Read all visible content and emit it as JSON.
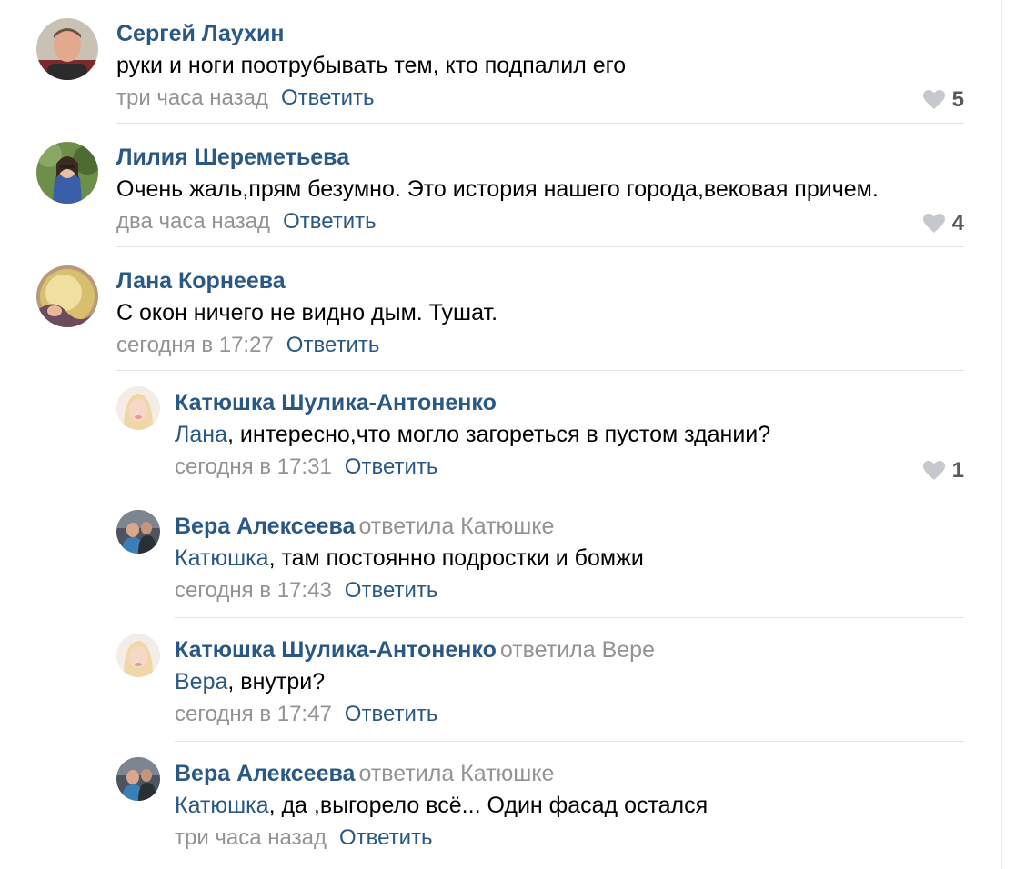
{
  "colors": {
    "author": "#2a5885",
    "meta": "#939393",
    "text": "#000000",
    "likes": "#555a5f",
    "divider": "#dfe2e8"
  },
  "comments": [
    {
      "author": "Сергей Лаухин",
      "replied_to": "",
      "mention": "",
      "text": "руки и ноги поотрубывать тем, кто подпалил его",
      "time": "три часа назад",
      "reply_label": "Ответить",
      "likes": "5",
      "like_icon": "heart-icon"
    },
    {
      "author": "Лилия Шереметьева",
      "replied_to": "",
      "mention": "",
      "text": "Очень жаль,прям безумно. Это история нашего города,вековая причем.",
      "time": "два часа назад",
      "reply_label": "Ответить",
      "likes": "4",
      "like_icon": "heart-icon"
    },
    {
      "author": "Лана Корнеева",
      "replied_to": "",
      "mention": "",
      "text": "С окон ничего не видно дым. Тушат.",
      "time": "сегодня в 17:27",
      "reply_label": "Ответить",
      "likes": "",
      "like_icon": "heart-icon"
    },
    {
      "author": "Катюшка Шулика-Антоненко",
      "replied_to": "",
      "mention": "Лана",
      "text": ", интересно,что могло загореться в пустом здании?",
      "time": "сегодня в 17:31",
      "reply_label": "Ответить",
      "likes": "1",
      "like_icon": "heart-icon"
    },
    {
      "author": "Вера Алексеева",
      "replied_to": "ответила Катюшке",
      "mention": "Катюшка",
      "text": ", там постоянно подростки и бомжи",
      "time": "сегодня в 17:43",
      "reply_label": "Ответить",
      "likes": "",
      "like_icon": "heart-icon"
    },
    {
      "author": "Катюшка Шулика-Антоненко",
      "replied_to": "ответила Вере",
      "mention": "Вера",
      "text": ", внутри?",
      "time": "сегодня в 17:47",
      "reply_label": "Ответить",
      "likes": "",
      "like_icon": "heart-icon"
    },
    {
      "author": "Вера Алексеева",
      "replied_to": "ответила Катюшке",
      "mention": "Катюшка",
      "text": ", да ,выгорело всё... Один фасад остался",
      "time": "три часа назад",
      "reply_label": "Ответить",
      "likes": "",
      "like_icon": "heart-icon"
    }
  ]
}
